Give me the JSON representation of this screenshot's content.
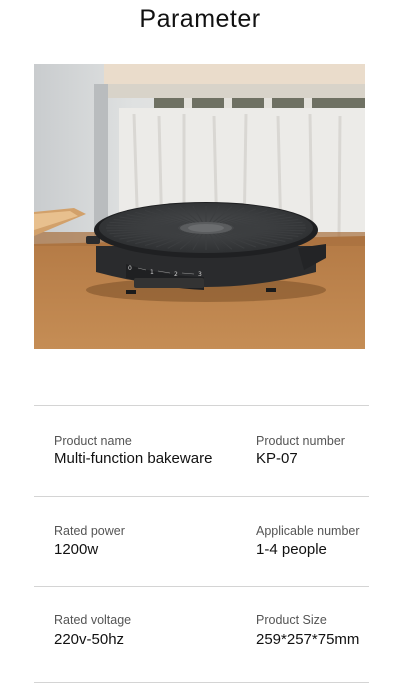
{
  "page": {
    "title": "Parameter"
  },
  "product_image": {
    "subject": "round electric grill pan",
    "dial_marks": [
      "0",
      "1",
      "2",
      "3"
    ]
  },
  "specs": [
    {
      "label": "Product name",
      "value": "Multi-function bakeware"
    },
    {
      "label": "Product number",
      "value": "KP-07"
    },
    {
      "label": "Rated power",
      "value": "1200w"
    },
    {
      "label": "Applicable number",
      "value": "1-4 people"
    },
    {
      "label": "Rated voltage",
      "value": "220v-50hz"
    },
    {
      "label": "Product Size",
      "value": "259*257*75mm"
    }
  ]
}
